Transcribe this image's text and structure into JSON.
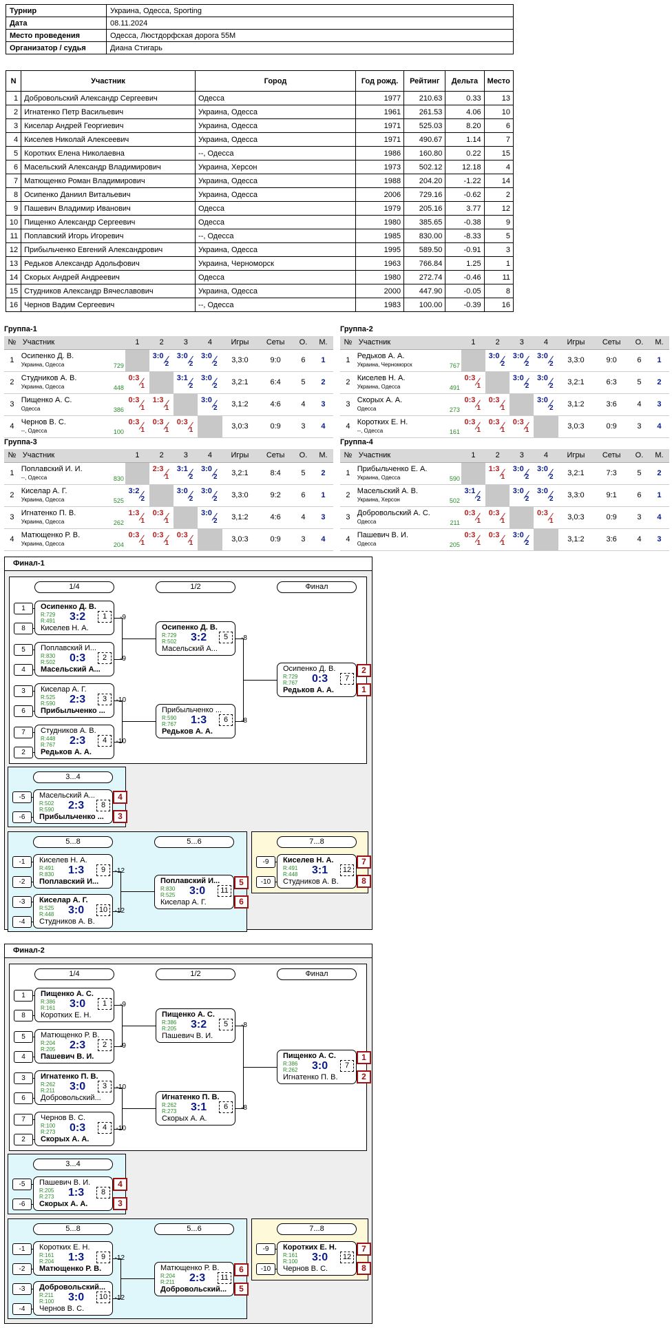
{
  "info": [
    [
      "Турнир",
      "Украина, Одесса, Sporting"
    ],
    [
      "Дата",
      "08.11.2024"
    ],
    [
      "Место проведения",
      "Одесса, Люстдорфская дорога 55М"
    ],
    [
      "Организатор / судья",
      "Диана Стигарь"
    ]
  ],
  "players_header": [
    "N",
    "Участник",
    "Город",
    "Год рожд.",
    "Рейтинг",
    "Дельта",
    "Место"
  ],
  "players": [
    [
      "1",
      "Добровольский Александр Сергеевич",
      "Одесса",
      "1977",
      "210.63",
      "0.33",
      "13"
    ],
    [
      "2",
      "Игнатенко Петр Васильевич",
      "Украина, Одесса",
      "1961",
      "261.53",
      "4.06",
      "10"
    ],
    [
      "3",
      "Киселар Андрей Георгиевич",
      "Украина, Одесса",
      "1971",
      "525.03",
      "8.20",
      "6"
    ],
    [
      "4",
      "Киселев Николай Алексеевич",
      "Украина, Одесса",
      "1971",
      "490.67",
      "1.14",
      "7"
    ],
    [
      "5",
      "Коротких Елена Николаевна",
      "--, Одесса",
      "1986",
      "160.80",
      "0.22",
      "15"
    ],
    [
      "6",
      "Масельский Александр Владимирович",
      "Украина, Херсон",
      "1973",
      "502.12",
      "12.18",
      "4"
    ],
    [
      "7",
      "Матющенко Роман Владимирович",
      "Украина, Одесса",
      "1988",
      "204.20",
      "-1.22",
      "14"
    ],
    [
      "8",
      "Осипенко Даниил Витальевич",
      "Украина, Одесса",
      "2006",
      "729.16",
      "-0.62",
      "2"
    ],
    [
      "9",
      "Пашевич Владимир Иванович",
      "Одесса",
      "1979",
      "205.16",
      "3.77",
      "12"
    ],
    [
      "10",
      "Пищенко Александр Сергеевич",
      "Одесса",
      "1980",
      "385.65",
      "-0.38",
      "9"
    ],
    [
      "11",
      "Поплавский Игорь Игоревич",
      "--, Одесса",
      "1985",
      "830.00",
      "-8.33",
      "5"
    ],
    [
      "12",
      "Прибыльченко Евгений Александрович",
      "Украина, Одесса",
      "1995",
      "589.50",
      "-0.91",
      "3"
    ],
    [
      "13",
      "Редьков Александр Адольфович",
      "Украина, Черноморск",
      "1963",
      "766.84",
      "1.25",
      "1"
    ],
    [
      "14",
      "Скорых Андрей Андреевич",
      "Одесса",
      "1980",
      "272.74",
      "-0.46",
      "11"
    ],
    [
      "15",
      "Студников Александр Вячеславович",
      "Украина, Одесса",
      "2000",
      "447.90",
      "-0.05",
      "8"
    ],
    [
      "16",
      "Чернов Вадим Сергеевич",
      "--, Одесса",
      "1983",
      "100.00",
      "-0.39",
      "16"
    ]
  ],
  "group_header": [
    "№",
    "Участник",
    "1",
    "2",
    "3",
    "4",
    "Игры",
    "Сеты",
    "О.",
    "М."
  ],
  "groups": [
    {
      "title": "Группа-1",
      "rows": [
        {
          "n": "1",
          "name": "Осипенко Д. В.",
          "city": "Украина, Одесса",
          "r": "729",
          "c": [
            null,
            [
              "3:0",
              "2",
              "w"
            ],
            [
              "3:0",
              "2",
              "w"
            ],
            [
              "3:0",
              "2",
              "w"
            ]
          ],
          "g": "3,3:0",
          "s": "9:0",
          "o": "6",
          "m": "1"
        },
        {
          "n": "2",
          "name": "Студников А. В.",
          "city": "Украина, Одесса",
          "r": "448",
          "c": [
            [
              "0:3",
              "1",
              "l"
            ],
            null,
            [
              "3:1",
              "2",
              "w"
            ],
            [
              "3:0",
              "2",
              "w"
            ]
          ],
          "g": "3,2:1",
          "s": "6:4",
          "o": "5",
          "m": "2"
        },
        {
          "n": "3",
          "name": "Пищенко А. С.",
          "city": "Одесса",
          "r": "386",
          "c": [
            [
              "0:3",
              "1",
              "l"
            ],
            [
              "1:3",
              "1",
              "l"
            ],
            null,
            [
              "3:0",
              "2",
              "w"
            ]
          ],
          "g": "3,1:2",
          "s": "4:6",
          "o": "4",
          "m": "3"
        },
        {
          "n": "4",
          "name": "Чернов В. С.",
          "city": "--, Одесса",
          "r": "100",
          "c": [
            [
              "0:3",
              "1",
              "l"
            ],
            [
              "0:3",
              "1",
              "l"
            ],
            [
              "0:3",
              "1",
              "l"
            ],
            null
          ],
          "g": "3,0:3",
          "s": "0:9",
          "o": "3",
          "m": "4"
        }
      ]
    },
    {
      "title": "Группа-2",
      "rows": [
        {
          "n": "1",
          "name": "Редьков А. А.",
          "city": "Украина, Черноморск",
          "r": "767",
          "c": [
            null,
            [
              "3:0",
              "2",
              "w"
            ],
            [
              "3:0",
              "2",
              "w"
            ],
            [
              "3:0",
              "2",
              "w"
            ]
          ],
          "g": "3,3:0",
          "s": "9:0",
          "o": "6",
          "m": "1"
        },
        {
          "n": "2",
          "name": "Киселев Н. А.",
          "city": "Украина, Одесса",
          "r": "491",
          "c": [
            [
              "0:3",
              "1",
              "l"
            ],
            null,
            [
              "3:0",
              "2",
              "w"
            ],
            [
              "3:0",
              "2",
              "w"
            ]
          ],
          "g": "3,2:1",
          "s": "6:3",
          "o": "5",
          "m": "2"
        },
        {
          "n": "3",
          "name": "Скорых А. А.",
          "city": "Одесса",
          "r": "273",
          "c": [
            [
              "0:3",
              "1",
              "l"
            ],
            [
              "0:3",
              "1",
              "l"
            ],
            null,
            [
              "3:0",
              "2",
              "w"
            ]
          ],
          "g": "3,1:2",
          "s": "3:6",
          "o": "4",
          "m": "3"
        },
        {
          "n": "4",
          "name": "Коротких Е. Н.",
          "city": "--, Одесса",
          "r": "161",
          "c": [
            [
              "0:3",
              "1",
              "l"
            ],
            [
              "0:3",
              "1",
              "l"
            ],
            [
              "0:3",
              "1",
              "l"
            ],
            null
          ],
          "g": "3,0:3",
          "s": "0:9",
          "o": "3",
          "m": "4"
        }
      ]
    },
    {
      "title": "Группа-3",
      "rows": [
        {
          "n": "1",
          "name": "Поплавский И. И.",
          "city": "--, Одесса",
          "r": "830",
          "c": [
            null,
            [
              "2:3",
              "1",
              "l"
            ],
            [
              "3:1",
              "2",
              "w"
            ],
            [
              "3:0",
              "2",
              "w"
            ]
          ],
          "g": "3,2:1",
          "s": "8:4",
          "o": "5",
          "m": "2"
        },
        {
          "n": "2",
          "name": "Киселар А. Г.",
          "city": "Украина, Одесса",
          "r": "525",
          "c": [
            [
              "3:2",
              "2",
              "w"
            ],
            null,
            [
              "3:0",
              "2",
              "w"
            ],
            [
              "3:0",
              "2",
              "w"
            ]
          ],
          "g": "3,3:0",
          "s": "9:2",
          "o": "6",
          "m": "1"
        },
        {
          "n": "3",
          "name": "Игнатенко П. В.",
          "city": "Украина, Одесса",
          "r": "262",
          "c": [
            [
              "1:3",
              "1",
              "l"
            ],
            [
              "0:3",
              "1",
              "l"
            ],
            null,
            [
              "3:0",
              "2",
              "w"
            ]
          ],
          "g": "3,1:2",
          "s": "4:6",
          "o": "4",
          "m": "3"
        },
        {
          "n": "4",
          "name": "Матющенко Р. В.",
          "city": "Украина, Одесса",
          "r": "204",
          "c": [
            [
              "0:3",
              "1",
              "l"
            ],
            [
              "0:3",
              "1",
              "l"
            ],
            [
              "0:3",
              "1",
              "l"
            ],
            null
          ],
          "g": "3,0:3",
          "s": "0:9",
          "o": "3",
          "m": "4"
        }
      ]
    },
    {
      "title": "Группа-4",
      "rows": [
        {
          "n": "1",
          "name": "Прибыльченко Е. А.",
          "city": "Украина, Одесса",
          "r": "590",
          "c": [
            null,
            [
              "1:3",
              "1",
              "l"
            ],
            [
              "3:0",
              "2",
              "w"
            ],
            [
              "3:0",
              "2",
              "w"
            ]
          ],
          "g": "3,2:1",
          "s": "7:3",
          "o": "5",
          "m": "2"
        },
        {
          "n": "2",
          "name": "Масельский А. В.",
          "city": "Украина, Херсон",
          "r": "502",
          "c": [
            [
              "3:1",
              "2",
              "w"
            ],
            null,
            [
              "3:0",
              "2",
              "w"
            ],
            [
              "3:0",
              "2",
              "w"
            ]
          ],
          "g": "3,3:0",
          "s": "9:1",
          "o": "6",
          "m": "1"
        },
        {
          "n": "3",
          "name": "Добровольский А. С.",
          "city": "Одесса",
          "r": "211",
          "c": [
            [
              "0:3",
              "1",
              "l"
            ],
            [
              "0:3",
              "1",
              "l"
            ],
            null,
            [
              "0:3",
              "1",
              "l"
            ]
          ],
          "g": "3,0:3",
          "s": "0:9",
          "o": "3",
          "m": "4"
        },
        {
          "n": "4",
          "name": "Пашевич В. И.",
          "city": "Одесса",
          "r": "205",
          "c": [
            [
              "0:3",
              "1",
              "l"
            ],
            [
              "0:3",
              "1",
              "l"
            ],
            [
              "3:0",
              "2",
              "w"
            ],
            null
          ],
          "g": "3,1:2",
          "s": "3:6",
          "o": "4",
          "m": "3"
        }
      ]
    }
  ],
  "finals": [
    {
      "title": "Финал-1",
      "labels": {
        "q": "1/4",
        "s": "1/2",
        "f": "Финал",
        "b34": "3...4",
        "b58": "5...8",
        "b56": "5...6",
        "b78": "7...8"
      },
      "seeds": [
        "1",
        "8",
        "5",
        "4",
        "3",
        "6",
        "7",
        "2",
        "-5",
        "-6",
        "-1",
        "-2",
        "-3",
        "-4",
        "-9",
        "-10"
      ],
      "next": [
        "-9",
        "-9",
        "-10",
        "-10",
        "-8",
        "-8",
        "-12",
        "-12"
      ],
      "matches": [
        {
          "p1": "Осипенко Д. В.",
          "p2": "Киселев Н. А.",
          "r1": "R:729",
          "r2": "R:491",
          "s": "3:2",
          "n": "1",
          "w": 1
        },
        {
          "p1": "Поплавский И...",
          "p2": "Масельский А...",
          "r1": "R:830",
          "r2": "R:502",
          "s": "0:3",
          "n": "2",
          "w": 2
        },
        {
          "p1": "Киселар А. Г.",
          "p2": "Прибыльченко ...",
          "r1": "R:525",
          "r2": "R:590",
          "s": "2:3",
          "n": "3",
          "w": 2
        },
        {
          "p1": "Студников А. В.",
          "p2": "Редьков А. А.",
          "r1": "R:448",
          "r2": "R:767",
          "s": "2:3",
          "n": "4",
          "w": 2
        },
        {
          "p1": "Осипенко Д. В.",
          "p2": "Масельский А...",
          "r1": "R:729",
          "r2": "R:502",
          "s": "3:2",
          "n": "5",
          "w": 1
        },
        {
          "p1": "Прибыльченко ...",
          "p2": "Редьков А. А.",
          "r1": "R:590",
          "r2": "R:767",
          "s": "1:3",
          "n": "6",
          "w": 2
        },
        {
          "p1": "Осипенко Д. В.",
          "p2": "Редьков А. А.",
          "r1": "R:729",
          "r2": "R:767",
          "s": "0:3",
          "n": "7",
          "w": 2,
          "pl": [
            "2",
            "1"
          ]
        },
        {
          "p1": "Масельский А...",
          "p2": "Прибыльченко ...",
          "r1": "R:502",
          "r2": "R:590",
          "s": "2:3",
          "n": "8",
          "w": 2,
          "pl": [
            "4",
            "3"
          ]
        },
        {
          "p1": "Киселев Н. А.",
          "p2": "Поплавский И...",
          "r1": "R:491",
          "r2": "R:830",
          "s": "1:3",
          "n": "9",
          "w": 2
        },
        {
          "p1": "Киселар А. Г.",
          "p2": "Студников А. В.",
          "r1": "R:525",
          "r2": "R:448",
          "s": "3:0",
          "n": "10",
          "w": 1
        },
        {
          "p1": "Поплавский И...",
          "p2": "Киселар А. Г.",
          "r1": "R:830",
          "r2": "R:525",
          "s": "3:0",
          "n": "11",
          "w": 1,
          "pl": [
            "5",
            "6"
          ]
        },
        {
          "p1": "Киселев Н. А.",
          "p2": "Студников А. В.",
          "r1": "R:491",
          "r2": "R:448",
          "s": "3:1",
          "n": "12",
          "w": 1,
          "pl": [
            "7",
            "8"
          ]
        }
      ]
    },
    {
      "title": "Финал-2",
      "labels": {
        "q": "1/4",
        "s": "1/2",
        "f": "Финал",
        "b34": "3...4",
        "b58": "5...8",
        "b56": "5...6",
        "b78": "7...8"
      },
      "seeds": [
        "1",
        "8",
        "5",
        "4",
        "3",
        "6",
        "7",
        "2",
        "-5",
        "-6",
        "-1",
        "-2",
        "-3",
        "-4",
        "-9",
        "-10"
      ],
      "next": [
        "-9",
        "-9",
        "-10",
        "-10",
        "-8",
        "-8",
        "-12",
        "-12"
      ],
      "matches": [
        {
          "p1": "Пищенко А. С.",
          "p2": "Коротких Е. Н.",
          "r1": "R:386",
          "r2": "R:161",
          "s": "3:0",
          "n": "1",
          "w": 1
        },
        {
          "p1": "Матющенко Р. В.",
          "p2": "Пашевич В. И.",
          "r1": "R:204",
          "r2": "R:205",
          "s": "2:3",
          "n": "2",
          "w": 2
        },
        {
          "p1": "Игнатенко П. В.",
          "p2": "Добровольский...",
          "r1": "R:262",
          "r2": "R:211",
          "s": "3:0",
          "n": "3",
          "w": 1
        },
        {
          "p1": "Чернов В. С.",
          "p2": "Скорых А. А.",
          "r1": "R:100",
          "r2": "R:273",
          "s": "0:3",
          "n": "4",
          "w": 2
        },
        {
          "p1": "Пищенко А. С.",
          "p2": "Пашевич В. И.",
          "r1": "R:386",
          "r2": "R:205",
          "s": "3:2",
          "n": "5",
          "w": 1
        },
        {
          "p1": "Игнатенко П. В.",
          "p2": "Скорых А. А.",
          "r1": "R:262",
          "r2": "R:273",
          "s": "3:1",
          "n": "6",
          "w": 1
        },
        {
          "p1": "Пищенко А. С.",
          "p2": "Игнатенко П. В.",
          "r1": "R:386",
          "r2": "R:262",
          "s": "3:0",
          "n": "7",
          "w": 1,
          "pl": [
            "1",
            "2"
          ]
        },
        {
          "p1": "Пашевич В. И.",
          "p2": "Скорых А. А.",
          "r1": "R:205",
          "r2": "R:273",
          "s": "1:3",
          "n": "8",
          "w": 2,
          "pl": [
            "4",
            "3"
          ]
        },
        {
          "p1": "Коротких Е. Н.",
          "p2": "Матющенко Р. В.",
          "r1": "R:161",
          "r2": "R:204",
          "s": "1:3",
          "n": "9",
          "w": 2
        },
        {
          "p1": "Добровольский...",
          "p2": "Чернов В. С.",
          "r1": "R:211",
          "r2": "R:100",
          "s": "3:0",
          "n": "10",
          "w": 1
        },
        {
          "p1": "Матющенко Р. В.",
          "p2": "Добровольский...",
          "r1": "R:204",
          "r2": "R:211",
          "s": "2:3",
          "n": "11",
          "w": 2,
          "pl": [
            "6",
            "5"
          ]
        },
        {
          "p1": "Коротких Е. Н.",
          "p2": "Чернов В. С.",
          "r1": "R:161",
          "r2": "R:100",
          "s": "3:0",
          "n": "12",
          "w": 1,
          "pl": [
            "7",
            "8"
          ]
        }
      ]
    }
  ]
}
